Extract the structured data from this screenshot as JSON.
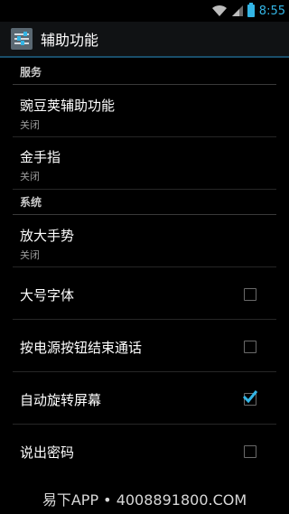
{
  "status_bar": {
    "time": "8:55"
  },
  "action_bar": {
    "title": "辅助功能",
    "app_icon": "settings-sliders-icon"
  },
  "sections": [
    {
      "header": "服务",
      "items": [
        {
          "title": "豌豆荚辅助功能",
          "summary": "关闭"
        },
        {
          "title": "金手指",
          "summary": "关闭"
        }
      ]
    },
    {
      "header": "系统",
      "items": [
        {
          "title": "放大手势",
          "summary": "关闭"
        },
        {
          "title": "大号字体",
          "checked": false
        },
        {
          "title": "按电源按钮结束通话",
          "checked": false
        },
        {
          "title": "自动旋转屏幕",
          "checked": true
        },
        {
          "title": "说出密码",
          "checked": false
        }
      ]
    }
  ],
  "watermark": "易下APP • 4008891800.COM",
  "colors": {
    "accent": "#33b5e5",
    "background": "#000000"
  }
}
